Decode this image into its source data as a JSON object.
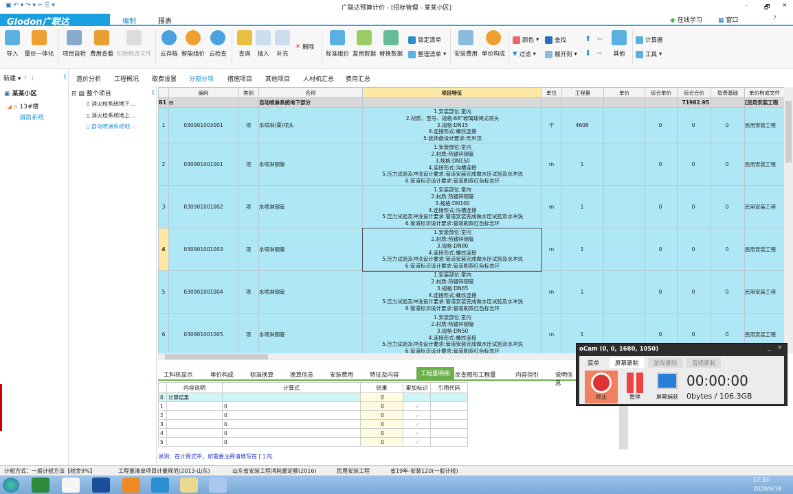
{
  "window": {
    "title": "广联达预算计价 - [招标管理 - 某某小区]",
    "min": "-",
    "max": "🗗",
    "close": "×"
  },
  "ribbon": {
    "logo": "Glodon广联达",
    "tabs": [
      "编制",
      "报表"
    ],
    "right": [
      "在线学习",
      "窗口",
      "?"
    ]
  },
  "toolbar": {
    "large": [
      "导入",
      "量价一体化",
      "项目自检",
      "费用查看",
      "切换税改文件",
      "云存档",
      "智能组价",
      "云检查",
      "查询",
      "插入",
      "补充",
      "标准组价",
      "复用数据",
      "替换数据",
      "安装费用",
      "单价构成",
      "其他"
    ],
    "small": {
      "delete": "删除",
      "lock": "锁定清单",
      "organize": "整理清单",
      "color": "颜色",
      "find": "查找",
      "filter": "过滤",
      "expand": "展开到",
      "calc": "计算器",
      "tools": "工具"
    }
  },
  "left": {
    "new": "新建",
    "project": "某某小区",
    "building": "13#楼",
    "system": "消防系统"
  },
  "tree": {
    "root": "整个项目",
    "items": [
      "消火栓系统地下...",
      "消火栓系统地上...",
      "自动喷淋系统地..."
    ]
  },
  "page_tabs": [
    "造价分析",
    "工程概况",
    "取费设置",
    "分部分项",
    "措施项目",
    "其他项目",
    "人材机汇总",
    "费用汇总"
  ],
  "table": {
    "headers": [
      "编码",
      "类别",
      "名称",
      "项目特征",
      "单位",
      "工程量",
      "单价",
      "综合单价",
      "综合合价",
      "取费基础",
      "单价构成文件"
    ],
    "part": {
      "rn": "B1",
      "name": "自动喷淋系统地下部分",
      "total": "71982.95",
      "file": "[民用安装工程"
    },
    "rows": [
      {
        "rn": "1",
        "code": "030901003001",
        "type": "项",
        "name": "水喷淋(雾)喷头",
        "desc": [
          "1.安装部位:室内",
          "2.材质、型号、规格:68°玻璃球闭式喷头",
          "3.规格:DN15",
          "4.连接形式:螺纹连接",
          "5.装饰盘设计要求:无吊顶"
        ],
        "unit": "个",
        "qty": "4608",
        "price": "",
        "cprice": "0",
        "ctotal": "0",
        "base": "0",
        "file": "民用安装工程"
      },
      {
        "rn": "2",
        "code": "030901001001",
        "type": "项",
        "name": "水喷淋钢管",
        "desc": [
          "1.安装部位:室内",
          "2.材质:热镀锌钢管",
          "3.规格:DN150",
          "4.连接形式:沟槽连接",
          "5.压力试验及冲洗设计要求:管道安装完成做水压试验及水冲洗",
          "6.管道标识设计要求:管道刷双红色标志环"
        ],
        "unit": "m",
        "qty": "1",
        "price": "",
        "cprice": "0",
        "ctotal": "0",
        "base": "0",
        "file": "民用安装工程"
      },
      {
        "rn": "3",
        "code": "030901001002",
        "type": "项",
        "name": "水喷淋钢管",
        "desc": [
          "1.安装部位:室内",
          "2.材质:热镀锌钢管",
          "3.规格:DN100",
          "4.连接形式:沟槽连接",
          "5.压力试验及冲洗设计要求:管道安装完成做水压试验及水冲洗",
          "6.管道标识设计要求:管道刷双红色标志环"
        ],
        "unit": "m",
        "qty": "1",
        "price": "",
        "cprice": "0",
        "ctotal": "0",
        "base": "0",
        "file": "民用安装工程"
      },
      {
        "rn": "4",
        "code": "030901001003",
        "type": "项",
        "name": "水喷淋钢管",
        "desc": [
          "1.安装部位:室内",
          "2.材质:热镀锌钢管",
          "3.规格:DN80",
          "4.连接形式:螺纹连接",
          "5.压力试验及冲洗设计要求:管道安装完成做水压试验及水冲洗",
          "6.管道标识设计要求:管道刷双红色标志环"
        ],
        "unit": "m",
        "qty": "1",
        "price": "",
        "cprice": "0",
        "ctotal": "0",
        "base": "0",
        "file": "民用安装工程"
      },
      {
        "rn": "5",
        "code": "030901001004",
        "type": "项",
        "name": "水喷淋钢管",
        "desc": [
          "1.安装部位:室内",
          "2.材质:热镀锌钢管",
          "3.规格:DN65",
          "4.连接形式:螺纹连接",
          "5.压力试验及冲洗设计要求:管道安装完成做水压试验及水冲洗",
          "6.管道标识设计要求:管道刷双红色标志环"
        ],
        "unit": "m",
        "qty": "1",
        "price": "",
        "cprice": "0",
        "ctotal": "0",
        "base": "0",
        "file": "民用安装工程"
      },
      {
        "rn": "6",
        "code": "030901001005",
        "type": "项",
        "name": "水喷淋钢管",
        "desc": [
          "1.安装部位:室内",
          "2.材质:热镀锌钢管",
          "3.规格:DN50",
          "4.连接形式:螺纹连接",
          "5.压力试验及冲洗设计要求:管道安装完成做水压试验及水冲洗",
          "6.管道标识设计要求:管道刷双红色标志环"
        ],
        "unit": "m",
        "qty": "1",
        "price": "",
        "cprice": "0",
        "ctotal": "0",
        "base": "0",
        "file": "民用安装工程"
      }
    ]
  },
  "bottom": {
    "tabs": [
      "工料机显示",
      "单价构成",
      "标准换算",
      "换算信息",
      "安装费用",
      "特征及内容",
      "工程量明细",
      "反查图形工程量",
      "内容指引",
      "说明信息"
    ],
    "active": 6,
    "headers": [
      "内容说明",
      "计算式",
      "结果",
      "累加标识",
      "引用代码"
    ],
    "rows": [
      {
        "n": "0",
        "desc": "计算结果",
        "formula": "",
        "result": "0",
        "check": ""
      },
      {
        "n": "1",
        "desc": "",
        "formula": "0",
        "result": "0",
        "check": "✓"
      },
      {
        "n": "2",
        "desc": "",
        "formula": "0",
        "result": "0",
        "check": "✓"
      },
      {
        "n": "3",
        "desc": "",
        "formula": "0",
        "result": "0",
        "check": "✓"
      },
      {
        "n": "4",
        "desc": "",
        "formula": "0",
        "result": "0",
        "check": "✓"
      },
      {
        "n": "5",
        "desc": "",
        "formula": "0",
        "result": "0",
        "check": "✓"
      }
    ],
    "note": "说明：在计算式中，如需要注释请填写在 [ ] 内."
  },
  "ocam": {
    "title": "oCam (0, 0, 1680, 1050)",
    "tabs": [
      "菜单",
      "屏幕录制",
      "游戏录制",
      "音频录制"
    ],
    "stop": "终止",
    "pause": "暂停",
    "capture": "屏幕捕获",
    "time": "00:00:00",
    "size": "0bytes / 106.3GB"
  },
  "status": [
    "计税方式：一般计税方法【税金9%】",
    "工程量清单项目计量规范(2013-山东)",
    "山东省安装工程消耗量定额(2016)",
    "民用安装工程",
    "省19年-安装120(一般计税)"
  ],
  "clock": {
    "time": "17:33",
    "date": "2020/9/18"
  }
}
